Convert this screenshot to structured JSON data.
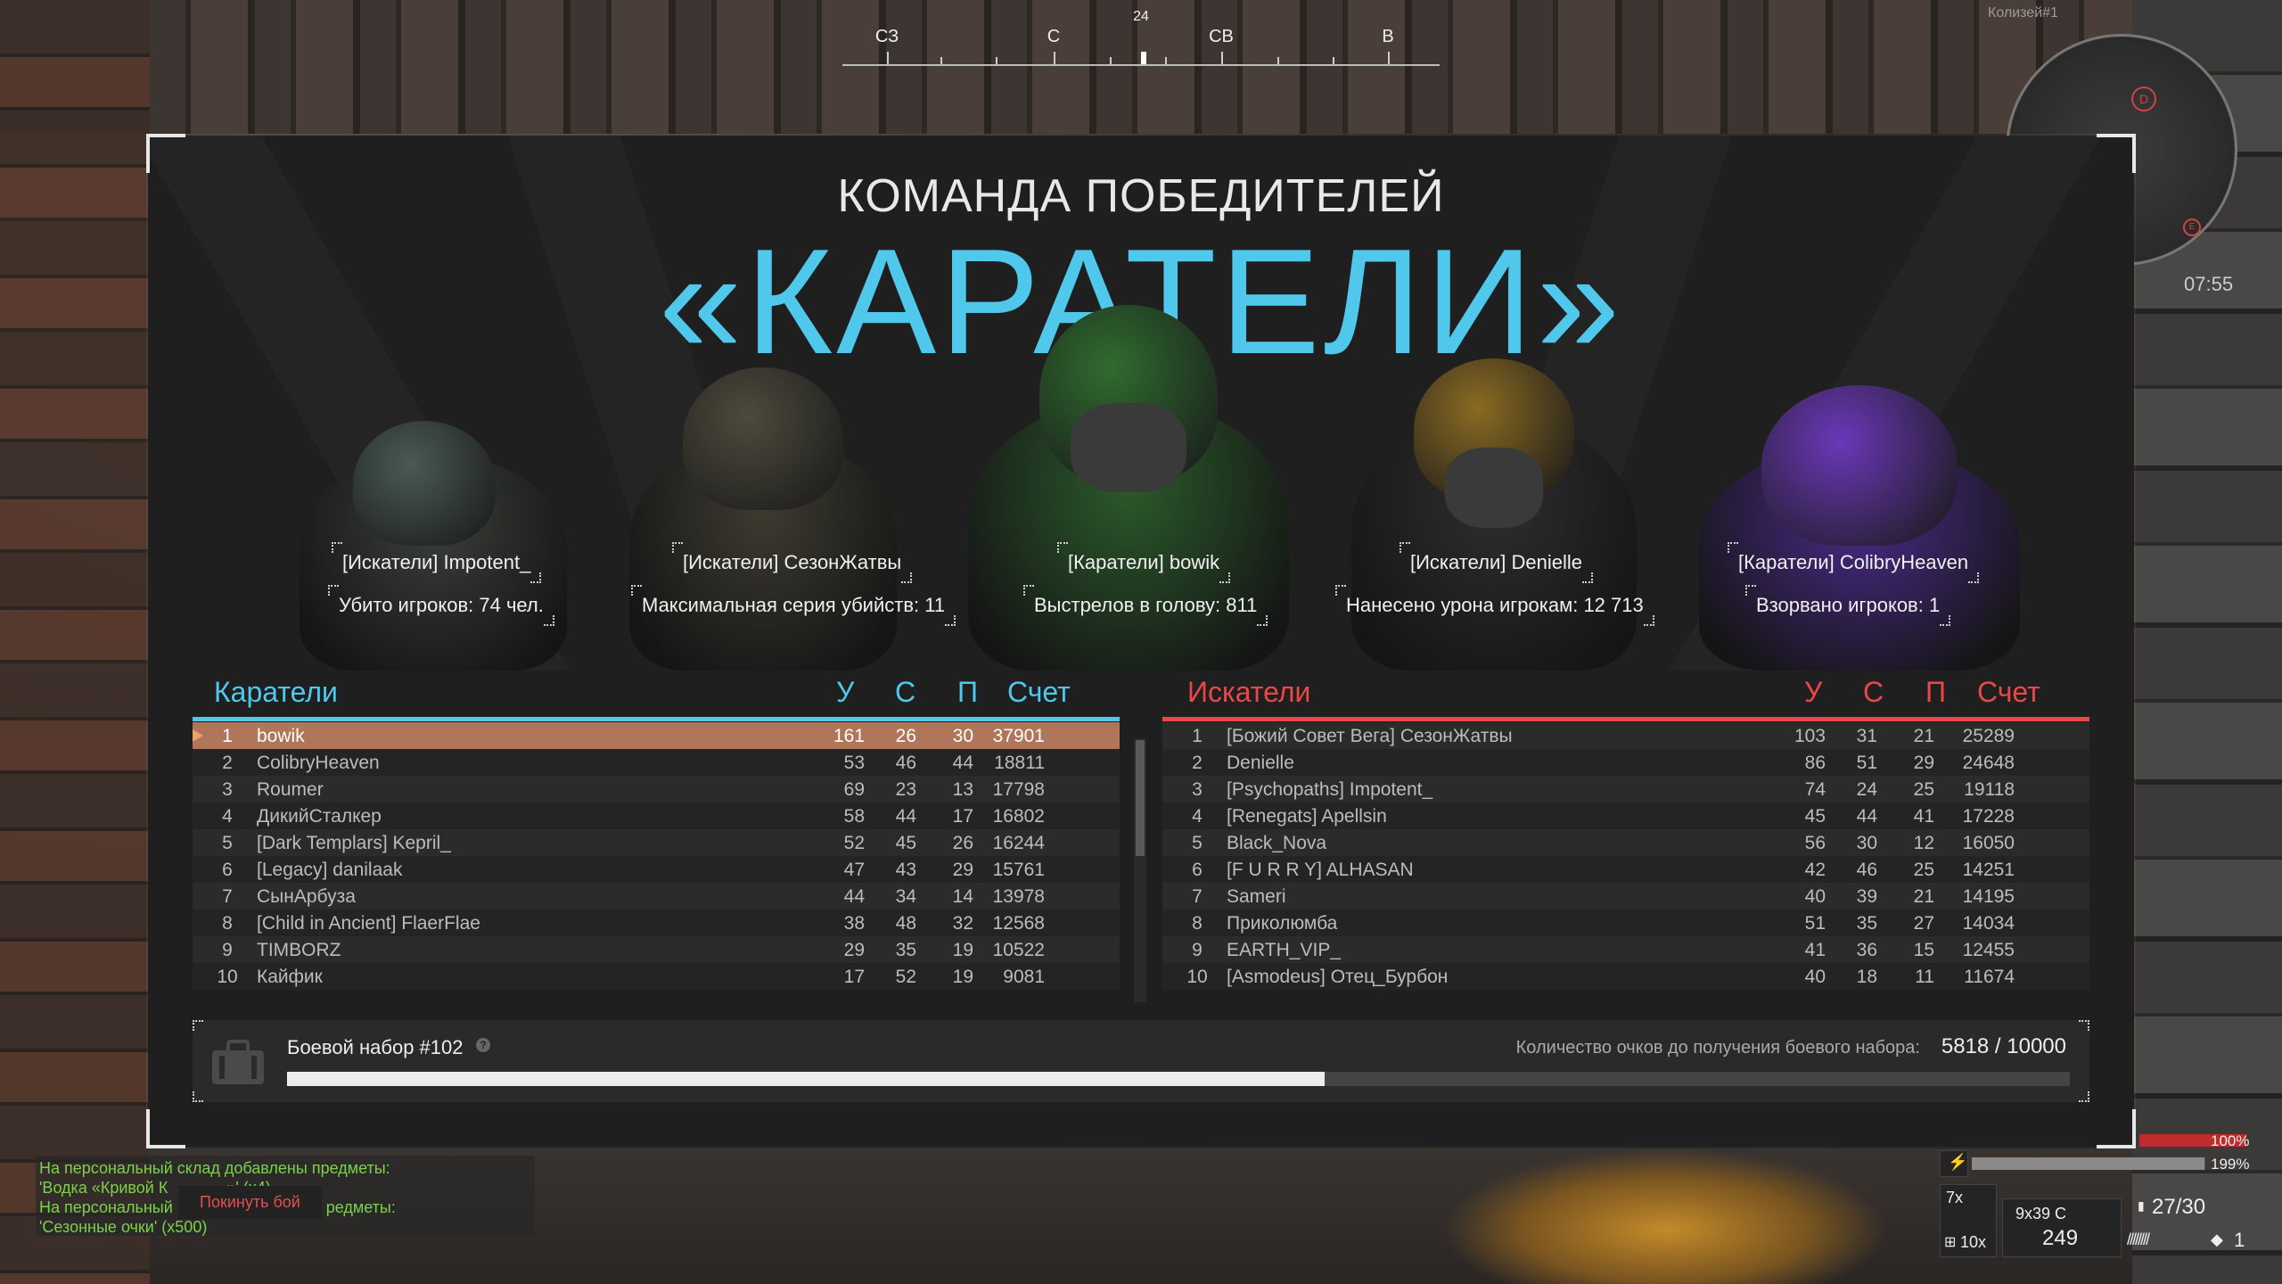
{
  "compass": {
    "heading": "24",
    "marks": [
      "СЗ",
      "С",
      "СВ",
      "В"
    ]
  },
  "minimap": {
    "label": "Колизей#1",
    "marker_a": "D",
    "marker_b": "E",
    "time": "07:55"
  },
  "winner": {
    "subtitle": "КОМАНДА ПОБЕДИТЕЛЕЙ",
    "title": "«КАРАТЕЛИ»"
  },
  "heroes": [
    {
      "name": "[Искатели] Impotent_",
      "stat": "Убито игроков: 74 чел.",
      "helmet": "#4a5a55",
      "body": "#3a3e3a"
    },
    {
      "name": "[Искатели] СезонЖатвы",
      "stat": "Максимальная серия убийств: 11",
      "helmet": "#4d4a3c",
      "body": "#3d3a30"
    },
    {
      "name": "[Каратели] bowik",
      "stat": "Выстрелов в голову: 811",
      "helmet": "#2f6b2f",
      "body": "#2b5a2b"
    },
    {
      "name": "[Искатели] Denielle",
      "stat": "Нанесено урона игрокам: 12 713",
      "helmet": "#8a6a22",
      "body": "#2e2e2e"
    },
    {
      "name": "[Каратели] ColibryHeaven",
      "stat": "Взорвано игроков: 1",
      "helmet": "#6a38b8",
      "body": "#4a2a8a"
    }
  ],
  "columns": {
    "kills": "У",
    "deaths": "С",
    "assists": "П",
    "score": "Счет"
  },
  "team_left": {
    "name": "Каратели",
    "color": "#4fc8ec",
    "rows": [
      {
        "n": "1",
        "player": "bowik",
        "k": "161",
        "d": "26",
        "a": "30",
        "s": "37901"
      },
      {
        "n": "2",
        "player": "ColibryHeaven",
        "k": "53",
        "d": "46",
        "a": "44",
        "s": "18811"
      },
      {
        "n": "3",
        "player": "Roumer",
        "k": "69",
        "d": "23",
        "a": "13",
        "s": "17798"
      },
      {
        "n": "4",
        "player": "ДикийСталкер",
        "k": "58",
        "d": "44",
        "a": "17",
        "s": "16802"
      },
      {
        "n": "5",
        "player": "[Dark Templars] Kepril_",
        "k": "52",
        "d": "45",
        "a": "26",
        "s": "16244"
      },
      {
        "n": "6",
        "player": "[Legacy] danilaak",
        "k": "47",
        "d": "43",
        "a": "29",
        "s": "15761"
      },
      {
        "n": "7",
        "player": "СынАрбуза",
        "k": "44",
        "d": "34",
        "a": "14",
        "s": "13978"
      },
      {
        "n": "8",
        "player": "[Child in Ancient] FlaerFlae",
        "k": "38",
        "d": "48",
        "a": "32",
        "s": "12568"
      },
      {
        "n": "9",
        "player": "TIMBORZ",
        "k": "29",
        "d": "35",
        "a": "19",
        "s": "10522"
      },
      {
        "n": "10",
        "player": "Кайфик",
        "k": "17",
        "d": "52",
        "a": "19",
        "s": "9081"
      }
    ]
  },
  "team_right": {
    "name": "Искатели",
    "color": "#e84848",
    "rows": [
      {
        "n": "1",
        "player": "[Божий Совет Вега] СезонЖатвы",
        "k": "103",
        "d": "31",
        "a": "21",
        "s": "25289"
      },
      {
        "n": "2",
        "player": "Denielle",
        "k": "86",
        "d": "51",
        "a": "29",
        "s": "24648"
      },
      {
        "n": "3",
        "player": "[Psychopaths] Impotent_",
        "k": "74",
        "d": "24",
        "a": "25",
        "s": "19118"
      },
      {
        "n": "4",
        "player": "[Renegats] Apellsin",
        "k": "45",
        "d": "44",
        "a": "41",
        "s": "17228"
      },
      {
        "n": "5",
        "player": "Black_Nova",
        "k": "56",
        "d": "30",
        "a": "12",
        "s": "16050"
      },
      {
        "n": "6",
        "player": "[F U R R Y] ALHASAN",
        "k": "42",
        "d": "46",
        "a": "25",
        "s": "14251"
      },
      {
        "n": "7",
        "player": "Sameri",
        "k": "40",
        "d": "39",
        "a": "21",
        "s": "14195"
      },
      {
        "n": "8",
        "player": "Приколюмба",
        "k": "51",
        "d": "35",
        "a": "27",
        "s": "14034"
      },
      {
        "n": "9",
        "player": "EARTH_VIP_",
        "k": "41",
        "d": "36",
        "a": "15",
        "s": "12455"
      },
      {
        "n": "10",
        "player": "[Asmodeus] Отец_Бурбон",
        "k": "40",
        "d": "18",
        "a": "11",
        "s": "11674"
      }
    ]
  },
  "kit": {
    "title": "Боевой набор #102",
    "help": "?",
    "points_label": "Количество очков до получения боевого набора:",
    "points": "5818 / 10000",
    "progress": 0.5818
  },
  "chat": {
    "lines": [
      "На персональный склад добавлены предметы:",
      "'Водка «Кривой К",
      "На персональный",
      "'Сезонные очки' (х500)"
    ],
    "line_2_tail": "»' (х4)",
    "line_3_tail": "редметы:",
    "leave_button": "Покинуть бой",
    "color": "#7ad24a"
  },
  "hud": {
    "health": "100%",
    "health_value": 1.0,
    "stamina": "199%",
    "stamina_value": 0.995,
    "scope": "7x",
    "scope_count": "10x",
    "ammo_type": "9x39 С",
    "ammo_reserve": "249",
    "ammo_mag": "27/30",
    "grenades": "1"
  }
}
